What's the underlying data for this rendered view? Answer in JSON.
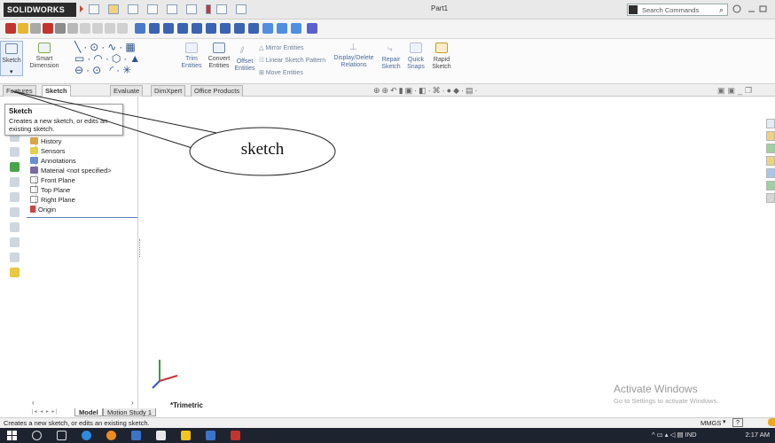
{
  "app": {
    "logo": "SOLIDWORKS",
    "document_title": "Part1"
  },
  "search": {
    "label": "Search Commands"
  },
  "ribbon": {
    "sketch": "Sketch",
    "smart_dimension_1": "Smart",
    "smart_dimension_2": "Dimension",
    "trim_1": "Trim",
    "trim_2": "Entities",
    "convert_1": "Convert",
    "convert_2": "Entities",
    "offset_1": "Offset",
    "offset_2": "Entities",
    "mirror": "Mirror Entities",
    "linear_pattern": "Linear Sketch Pattern",
    "move": "Move Entities",
    "display_delete_1": "Display/Delete",
    "display_delete_2": "Relations",
    "repair_1": "Repair",
    "repair_2": "Sketch",
    "quick_snaps_1": "Quick",
    "quick_snaps_2": "Snaps",
    "rapid_1": "Rapid",
    "rapid_2": "Sketch"
  },
  "tabs": [
    "Features",
    "Sketch",
    "Evaluate",
    "DimXpert",
    "Office Products"
  ],
  "tooltip": {
    "title": "Sketch",
    "desc_1": "Creates a new sketch, or edits an",
    "desc_2": "existing sketch."
  },
  "tree": {
    "history": "History",
    "sensors": "Sensors",
    "annotations": "Annotations",
    "material": "Material <not specified>",
    "front_plane": "Front Plane",
    "top_plane": "Top Plane",
    "right_plane": "Right Plane",
    "origin": "Origin"
  },
  "callout": {
    "text": "sketch"
  },
  "viewport": {
    "view_name": "*Trimetric"
  },
  "watermark": {
    "title": "Activate Windows",
    "subtitle": "Go to Settings to activate Windows."
  },
  "bottom_tabs": [
    "Model",
    "Motion Study 1"
  ],
  "status": {
    "message": "Creates a new sketch, or edits an existing sketch.",
    "units": "MMGS",
    "help": "?"
  },
  "taskbar": {
    "lang": "IND",
    "time": "2:17 AM"
  },
  "colors": {
    "accent": "#f0a81e",
    "ribbon_text": "#4b6a99",
    "taskbar": "#1e2330"
  }
}
